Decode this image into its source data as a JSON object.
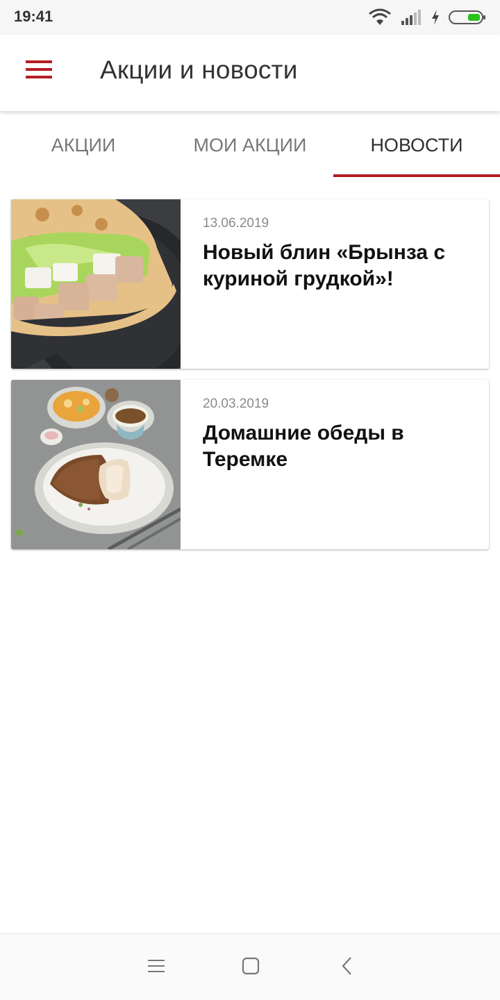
{
  "status_bar": {
    "time": "19:41",
    "icons": [
      "wifi-icon",
      "signal-icon",
      "charging-icon",
      "battery-icon"
    ],
    "battery_color": "#2bc11d"
  },
  "app_bar": {
    "title": "Акции и новости",
    "menu_icon": "hamburger-menu-icon",
    "accent_color": "#b41e24"
  },
  "tabs": [
    {
      "label": "АКЦИИ",
      "active": false
    },
    {
      "label": "МОИ АКЦИИ",
      "active": false
    },
    {
      "label": "НОВОСТИ",
      "active": true
    }
  ],
  "news": [
    {
      "date": "13.06.2019",
      "title": "Новый блин «Брынза с куриной грудкой»!",
      "image": "crepe-with-chicken-photo"
    },
    {
      "date": "20.03.2019",
      "title": "Домашние обеды в Теремке",
      "image": "buckwheat-lunch-photo"
    }
  ],
  "nav_bar": {
    "icons": [
      "recent-apps-icon",
      "home-icon",
      "back-icon"
    ]
  }
}
